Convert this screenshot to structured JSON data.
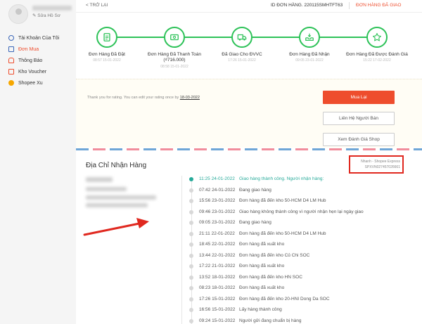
{
  "sidebar": {
    "edit_profile": "✎ Sửa Hồ Sơ",
    "items": [
      {
        "label": "Tài Khoản Của Tôi",
        "icon": "user-icon"
      },
      {
        "label": "Đơn Mua",
        "icon": "clipboard-icon"
      },
      {
        "label": "Thông Báo",
        "icon": "bell-icon"
      },
      {
        "label": "Kho Voucher",
        "icon": "voucher-icon"
      },
      {
        "label": "Shopee Xu",
        "icon": "coin-icon"
      }
    ]
  },
  "header": {
    "back": "< TRỞ LẠI",
    "order_id": "ID ĐƠN HÀNG. 220115SMHTFT63",
    "status": "ĐƠN HÀNG ĐÃ GIAO"
  },
  "steps": [
    {
      "title": "Đơn Hàng Đã Đặt",
      "time": "08:57 15-01-2022",
      "icon": "receipt-icon"
    },
    {
      "title": "Đơn Hàng Đã Thanh Toán (₫716.000)",
      "time": "08:58 15-01-2022",
      "icon": "money-icon"
    },
    {
      "title": "Đã Giao Cho ĐVVC",
      "time": "17:26 15-01-2022",
      "icon": "truck-icon"
    },
    {
      "title": "Đơn Hàng Đã Nhận",
      "time": "09:05 23-01-2022",
      "icon": "inbox-icon"
    },
    {
      "title": "Đơn Hàng Đã Được Đánh Giá",
      "time": "15:22 17-02-2022",
      "icon": "star-icon"
    }
  ],
  "rating": {
    "text": "Thank you for rating. You can edit your rating once by",
    "date": "18-03-2022"
  },
  "buttons": {
    "buy_again": "Mua Lại",
    "contact": "Liên Hệ Người Bán",
    "view_shop_review": "Xem Đánh Giá Shop"
  },
  "address": {
    "title": "Địa Chỉ Nhận Hàng"
  },
  "carrier": {
    "name": "Nhanh - Shopee Express",
    "tracking": "SPXVN027457026661"
  },
  "colors": {
    "accent": "#ee4d2d",
    "step_green": "#2dc258",
    "track_active": "#26aa99",
    "annotation_red": "#e0281f"
  },
  "tracking": [
    {
      "time": "11:25 24-01-2022",
      "desc": "Giao hàng thành công. Người nhận hàng:",
      "active": true
    },
    {
      "time": "07:42 24-01-2022",
      "desc": "Đang giao hàng"
    },
    {
      "time": "15:56 23-01-2022",
      "desc": "Đơn hàng đã đến kho 50-HCM D4 LM Hub"
    },
    {
      "time": "09:46 23-01-2022",
      "desc": "Giao hàng không thành công vì người nhận hẹn lại ngày giao"
    },
    {
      "time": "09:05 23-01-2022",
      "desc": "Đang giao hàng"
    },
    {
      "time": "21:11 22-01-2022",
      "desc": "Đơn hàng đã đến kho 50-HCM D4 LM Hub"
    },
    {
      "time": "18:45 22-01-2022",
      "desc": "Đơn hàng đã xuất kho"
    },
    {
      "time": "13:44 22-01-2022",
      "desc": "Đơn hàng đã đến kho Củ Chi SOC"
    },
    {
      "time": "17:22 21-01-2022",
      "desc": "Đơn hàng đã xuất kho"
    },
    {
      "time": "13:52 18-01-2022",
      "desc": "Đơn hàng đã đến kho HN SOC"
    },
    {
      "time": "08:23 18-01-2022",
      "desc": "Đơn hàng đã xuất kho"
    },
    {
      "time": "17:26 15-01-2022",
      "desc": "Đơn hàng đã đến kho 20-HNI Dong Da SOC"
    },
    {
      "time": "16:56 15-01-2022",
      "desc": "Lấy hàng thành công"
    },
    {
      "time": "09:24 15-01-2022",
      "desc": "Người gửi đang chuẩn bị hàng"
    }
  ]
}
